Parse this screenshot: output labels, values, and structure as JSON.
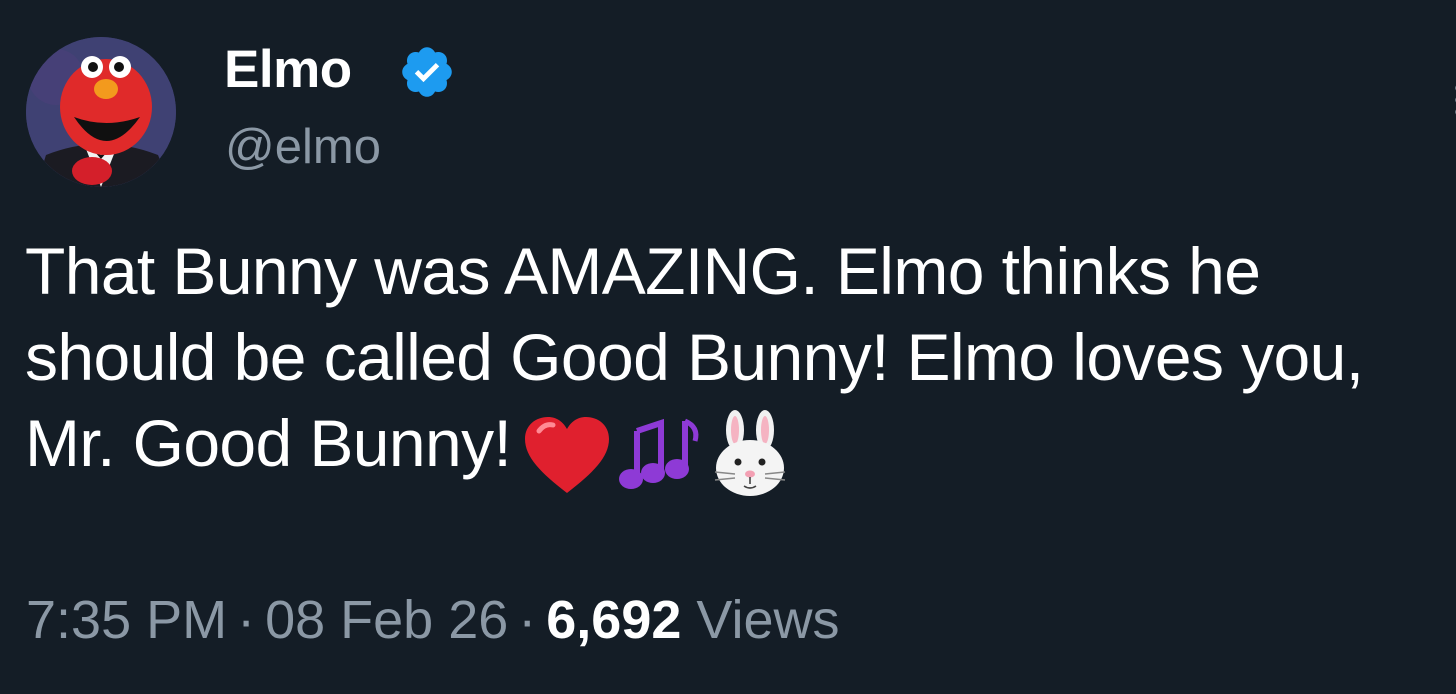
{
  "author": {
    "display_name": "Elmo",
    "handle": "@elmo",
    "verified": true
  },
  "tweet": {
    "text": "That Bunny was AMAZING. Elmo thinks he should be called Good Bunny! Elmo loves you, Mr. Good Bunny!",
    "emojis": [
      "red-heart",
      "musical-notes",
      "rabbit-face"
    ]
  },
  "meta": {
    "time": "7:35 PM",
    "separator": "·",
    "date": "08 Feb 26",
    "views_count": "6,692",
    "views_label": "Views"
  },
  "colors": {
    "background": "#141d26",
    "text": "#ffffff",
    "secondary_text": "#8b98a5",
    "verified": "#1d9bf0"
  }
}
